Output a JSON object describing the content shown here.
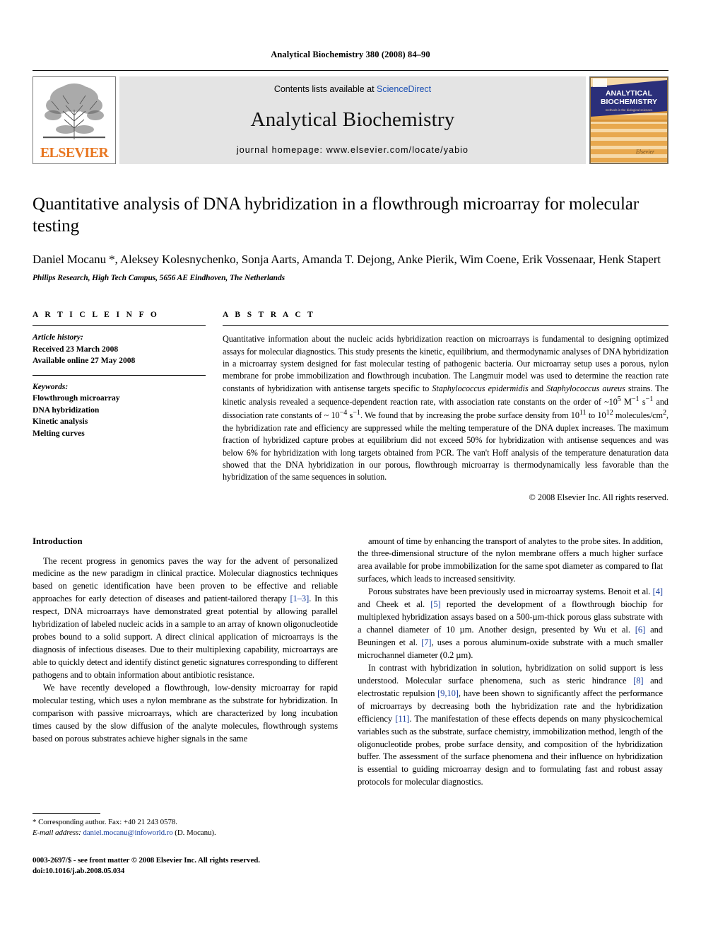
{
  "running_head": "Analytical Biochemistry 380 (2008) 84–90",
  "masthead": {
    "publisher_name": "ELSEVIER",
    "contents_prefix": "Contents lists available at ",
    "sciencedirect": "ScienceDirect",
    "journal_name": "Analytical Biochemistry",
    "homepage": "journal homepage: www.elsevier.com/locate/yabio",
    "cover_title_line1": "ANALYTICAL",
    "cover_title_line2": "BIOCHEMISTRY",
    "cover_subtitle": "methods in the biological sciences",
    "cover_publisher": "Elsevier",
    "accent_orange": "#E87722",
    "link_blue": "#1a4fb4",
    "cover_band_blue": "#2b2f7a"
  },
  "article": {
    "title": "Quantitative analysis of DNA hybridization in a flowthrough microarray for molecular testing",
    "authors": "Daniel Mocanu *, Aleksey Kolesnychenko, Sonja Aarts, Amanda T. Dejong, Anke Pierik, Wim Coene, Erik Vossenaar, Henk Stapert",
    "affiliation": "Philips Research, High Tech Campus, 5656 AE Eindhoven, The Netherlands"
  },
  "article_info": {
    "heading": "A R T I C L E    I N F O",
    "history_label": "Article history:",
    "received": "Received 23 March 2008",
    "available_online": "Available online 27 May 2008",
    "keywords_label": "Keywords:",
    "keywords": [
      "Flowthrough microarray",
      "DNA hybridization",
      "Kinetic analysis",
      "Melting curves"
    ]
  },
  "abstract": {
    "heading": "A B S T R A C T",
    "text_part1": "Quantitative information about the nucleic acids hybridization reaction on microarrays is fundamental to designing optimized assays for molecular diagnostics. This study presents the kinetic, equilibrium, and thermodynamic analyses of DNA hybridization in a microarray system designed for fast molecular testing of pathogenic bacteria. Our microarray setup uses a porous, nylon membrane for probe immobilization and flowthrough incubation. The Langmuir model was used to determine the reaction rate constants of hybridization with antisense targets specific to ",
    "species1": "Staphylococcus epidermidis",
    "text_part2": " and ",
    "species2": "Staphylococcus aureus",
    "text_part3": " strains. The kinetic analysis revealed a sequence-dependent reaction rate, with association rate constants on the order of ~10",
    "sup1": "5",
    "text_part4": " M",
    "sup2": "−1",
    "text_part5": " s",
    "sup3": "−1",
    "text_part6": " and dissociation rate constants of ~ 10",
    "sup4": "−4",
    "text_part7": " s",
    "sup5": "−1",
    "text_part8": ". We found that by increasing the probe surface density from 10",
    "sup6": "11",
    "text_part9": " to 10",
    "sup7": "12",
    "text_part10": " molecules/cm",
    "sup8": "2",
    "text_part11": ", the hybridization rate and efficiency are suppressed while the melting temperature of the DNA duplex increases. The maximum fraction of hybridized capture probes at equilibrium did not exceed 50% for hybridization with antisense sequences and was below 6% for hybridization with long targets obtained from PCR. The van't Hoff analysis of the temperature denaturation data showed that the DNA hybridization in our porous, flowthrough microarray is thermodynamically less favorable than the hybridization of the same sequences in solution.",
    "copyright": "© 2008 Elsevier Inc. All rights reserved."
  },
  "introduction": {
    "heading": "Introduction",
    "left_p1_a": "The recent progress in genomics paves the way for the advent of personalized medicine as the new paradigm in clinical practice. Molecular diagnostics techniques based on genetic identification have been proven to be effective and reliable approaches for early detection of diseases and patient-tailored therapy ",
    "left_p1_ref1": "[1–3]",
    "left_p1_b": ". In this respect, DNA microarrays have demonstrated great potential by allowing parallel hybridization of labeled nucleic acids in a sample to an array of known oligonucleotide probes bound to a solid support. A direct clinical application of microarrays is the diagnosis of infectious diseases. Due to their multiplexing capability, microarrays are able to quickly detect and identify distinct genetic signatures corresponding to different pathogens and to obtain information about antibiotic resistance.",
    "left_p2": "We have recently developed a flowthrough, low-density microarray for rapid molecular testing, which uses a nylon membrane as the substrate for hybridization. In comparison with passive microarrays, which are characterized by long incubation times caused by the slow diffusion of the analyte molecules, flowthrough systems based on porous substrates achieve higher signals in the same",
    "right_p1": "amount of time by enhancing the transport of analytes to the probe sites. In addition, the three-dimensional structure of the nylon membrane offers a much higher surface area available for probe immobilization for the same spot diameter as compared to flat surfaces, which leads to increased sensitivity.",
    "right_p2_a": "Porous substrates have been previously used in microarray systems. Benoit et al. ",
    "right_p2_ref1": "[4]",
    "right_p2_b": " and Cheek et al. ",
    "right_p2_ref2": "[5]",
    "right_p2_c": " reported the development of a flowthrough biochip for multiplexed hybridization assays based on a 500-µm-thick porous glass substrate with a channel diameter of 10 µm. Another design, presented by Wu et al. ",
    "right_p2_ref3": "[6]",
    "right_p2_d": " and Beuningen et al. ",
    "right_p2_ref4": "[7]",
    "right_p2_e": ", uses a porous aluminum-oxide substrate with a much smaller microchannel diameter (0.2 µm).",
    "right_p3_a": "In contrast with hybridization in solution, hybridization on solid support is less understood. Molecular surface phenomena, such as steric hindrance ",
    "right_p3_ref1": "[8]",
    "right_p3_b": " and electrostatic repulsion ",
    "right_p3_ref2": "[9,10]",
    "right_p3_c": ", have been shown to significantly affect the performance of microarrays by decreasing both the hybridization rate and the hybridization efficiency ",
    "right_p3_ref3": "[11]",
    "right_p3_d": ". The manifestation of these effects depends on many physicochemical variables such as the substrate, surface chemistry, immobilization method, length of the oligonucleotide probes, probe surface density, and composition of the hybridization buffer. The assessment of the surface phenomena and their influence on hybridization is essential to guiding microarray design and to formulating fast and robust assay protocols for molecular diagnostics."
  },
  "footer": {
    "corresponding_marker": "*",
    "corresponding_author": "Corresponding author. Fax: +40 21 243 0578.",
    "email_label": "E-mail address:",
    "email_address": "daniel.mocanu@infoworld.ro",
    "email_suffix": "(D. Mocanu).",
    "issn_line": "0003-2697/$ - see front matter © 2008 Elsevier Inc. All rights reserved.",
    "doi_line": "doi:10.1016/j.ab.2008.05.034"
  }
}
